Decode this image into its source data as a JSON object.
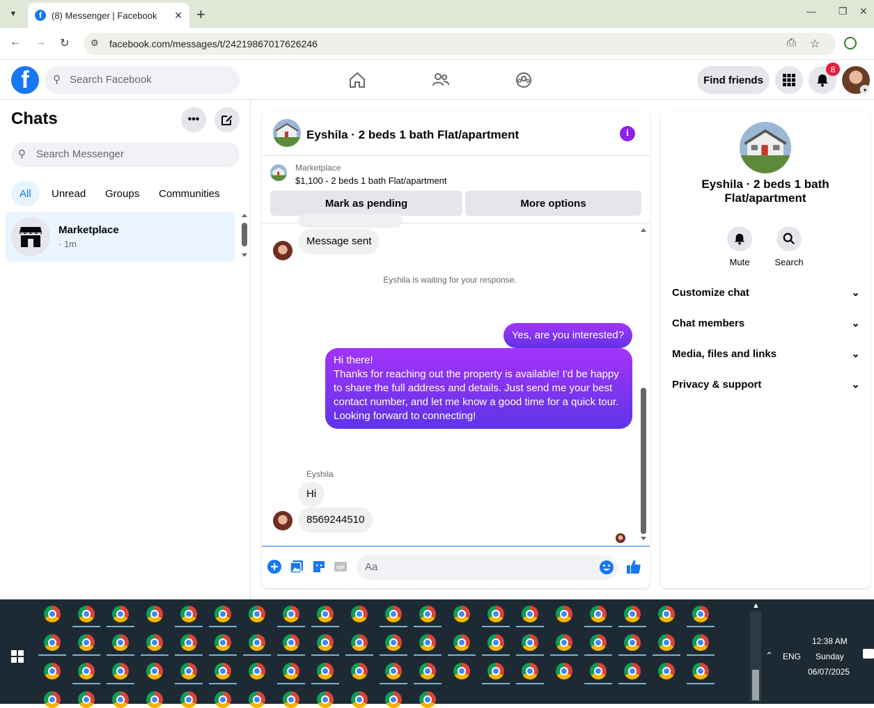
{
  "browser": {
    "tab_title": "(8) Messenger | Facebook",
    "url": "facebook.com/messages/t/24219867017626246"
  },
  "header": {
    "search_placeholder": "Search Facebook",
    "find_friends_label": "Find friends",
    "notification_count": "8"
  },
  "sidebar": {
    "title": "Chats",
    "search_placeholder": "Search Messenger",
    "filters": [
      "All",
      "Unread",
      "Groups",
      "Communities"
    ],
    "active_filter": "All",
    "chats": [
      {
        "name": "Marketplace",
        "meta": "· 1m"
      }
    ]
  },
  "conversation": {
    "title": "Eyshila · 2 beds 1 bath Flat/apartment",
    "marketplace_label": "Marketplace",
    "listing": "$1,100 - 2 beds 1 bath Flat/apartment",
    "mark_pending_label": "Mark as pending",
    "more_options_label": "More options",
    "messages": {
      "incoming_1": "Message sent",
      "system_note": "Eyshila is waiting for your response.",
      "outgoing_1": "Yes, are you interested?",
      "outgoing_2_lines": [
        "Hi there!",
        "Thanks for reaching out the property is available! I'd be happy",
        "to share the full address and details. Just send me your best",
        "contact number, and let me know a good time for a quick tour.",
        "Looking forward to connecting!"
      ],
      "sender_name": "Eyshila",
      "incoming_2": "Hi",
      "incoming_3": "8569244510"
    },
    "composer_placeholder": "Aa"
  },
  "details": {
    "name": "Eyshila · 2 beds 1 bath Flat/apartment",
    "actions": {
      "mute": "Mute",
      "search": "Search"
    },
    "sections": [
      "Customize chat",
      "Chat members",
      "Media, files and links",
      "Privacy & support"
    ]
  },
  "taskbar": {
    "time": "12:38 AM",
    "day": "Sunday",
    "date": "06/07/2025",
    "lang": "ENG"
  },
  "colors": {
    "fb_blue": "#1877f2",
    "outgoing_bubble_top": "#a334fa",
    "outgoing_bubble_bottom": "#5e34e6",
    "info_purple": "#8e21e8",
    "badge_red": "#e41e3f"
  }
}
